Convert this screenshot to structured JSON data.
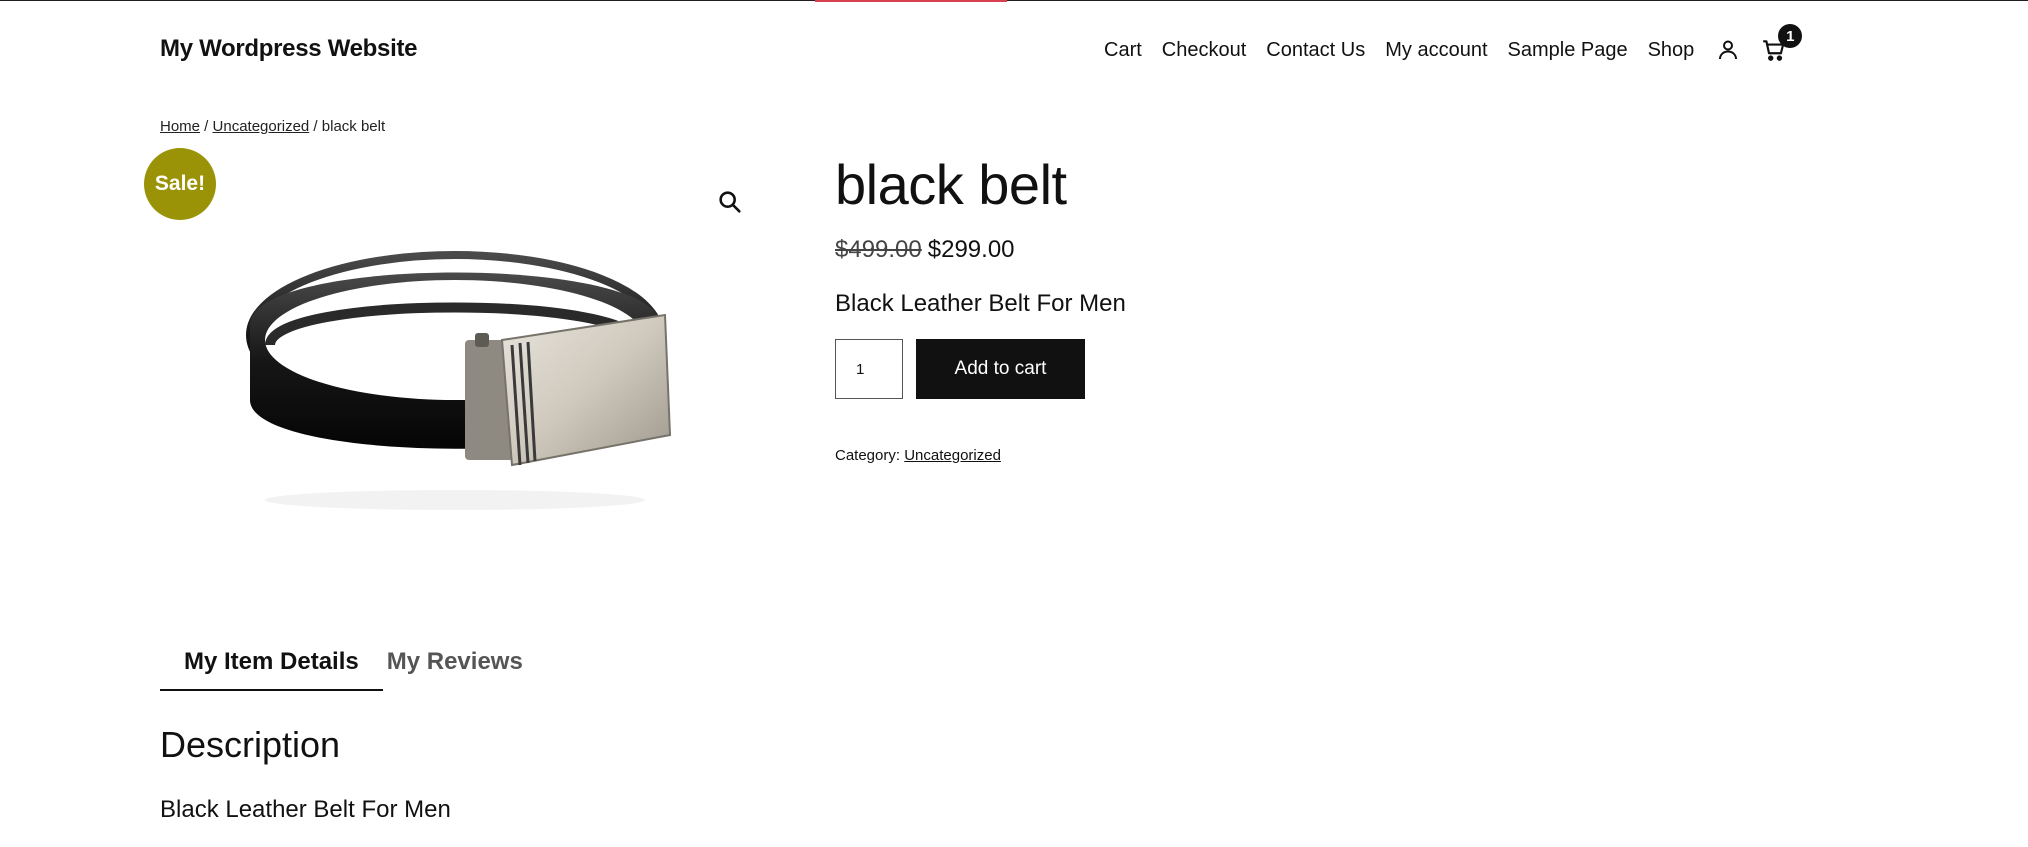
{
  "site": {
    "title": "My Wordpress Website"
  },
  "nav": {
    "items": [
      "Cart",
      "Checkout",
      "Contact Us",
      "My account",
      "Sample Page",
      "Shop"
    ],
    "cart_count": "1",
    "icons": [
      "account-icon",
      "cart-icon"
    ]
  },
  "breadcrumb": {
    "home": "Home",
    "sep1": " / ",
    "category": "Uncategorized",
    "sep2": " / ",
    "current": "black belt"
  },
  "product": {
    "sale_badge": "Sale!",
    "title": "black belt",
    "old_price": "$499.00",
    "price": "$299.00",
    "short_description": "Black Leather Belt For Men",
    "quantity": "1",
    "add_to_cart_label": "Add to cart",
    "category_label": "Category: ",
    "category_value": "Uncategorized"
  },
  "tabs": [
    {
      "label": "My Item Details",
      "active": true
    },
    {
      "label": "My Reviews",
      "active": false
    }
  ],
  "description": {
    "heading": "Description",
    "body": "Black Leather Belt For Men"
  },
  "colors": {
    "sale_badge": "#9b9307",
    "button": "#111111",
    "accent_line": "#d9404f"
  }
}
